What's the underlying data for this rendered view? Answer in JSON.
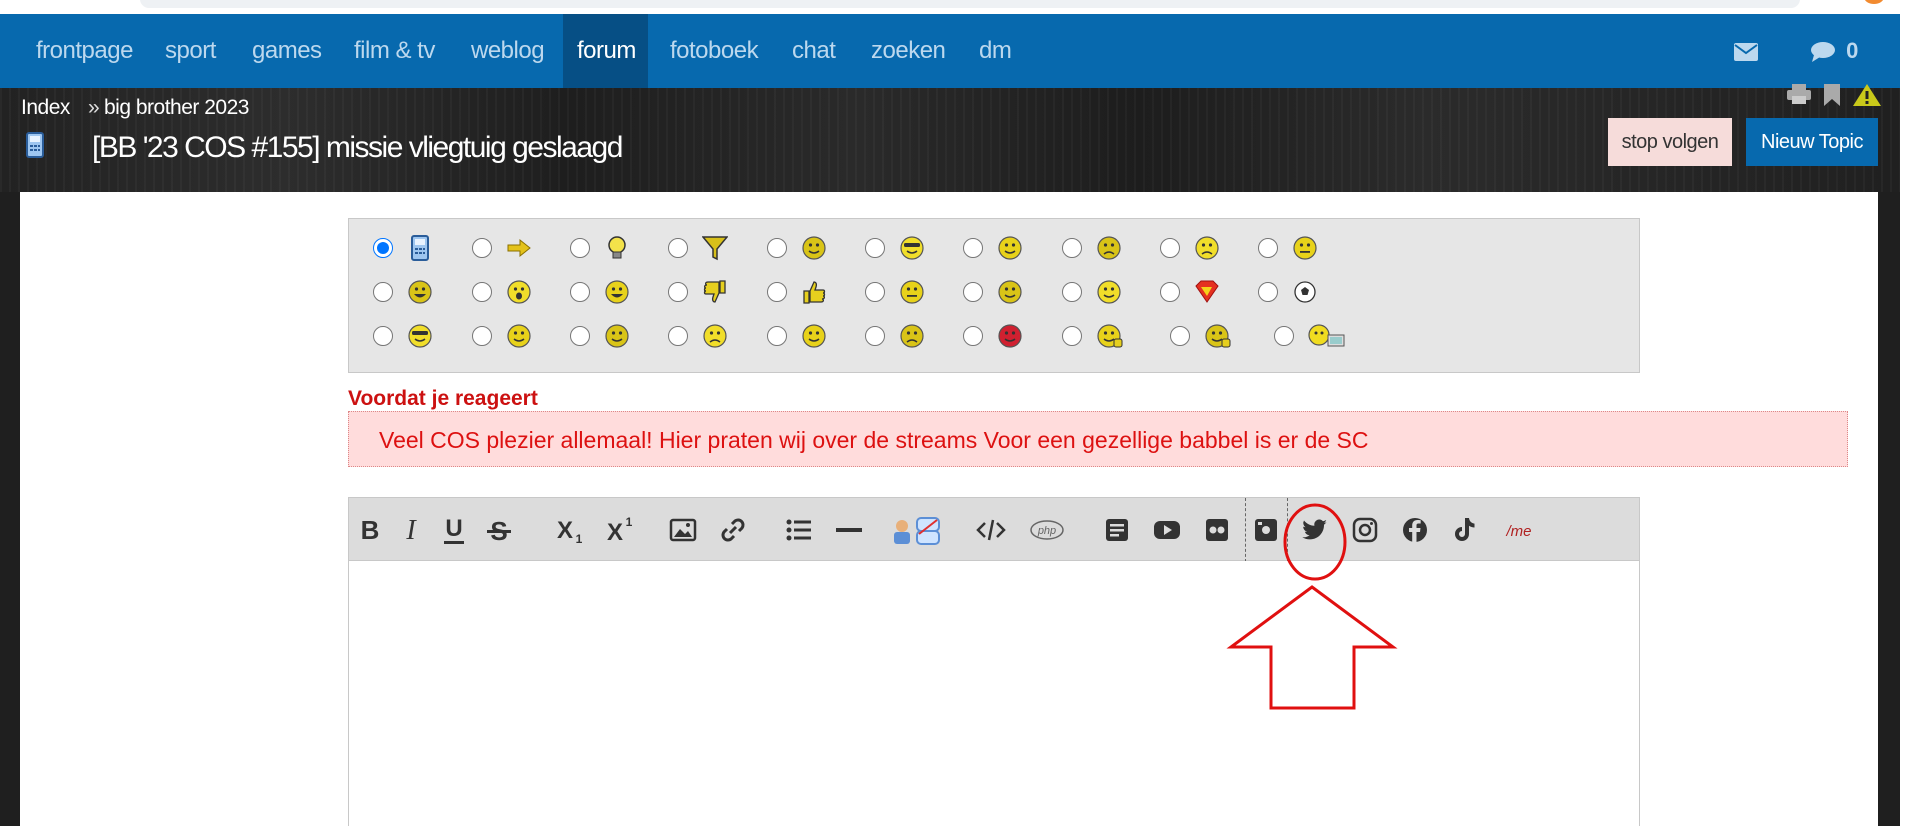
{
  "nav": {
    "items": [
      {
        "label": "frontpage"
      },
      {
        "label": "sport"
      },
      {
        "label": "games"
      },
      {
        "label": "film & tv"
      },
      {
        "label": "weblog"
      },
      {
        "label": "forum",
        "active": true
      },
      {
        "label": "fotoboek"
      },
      {
        "label": "chat"
      },
      {
        "label": "zoeken"
      },
      {
        "label": "dm"
      }
    ],
    "messages_count": "0",
    "icons": [
      "mail-icon",
      "chat-bubble-icon"
    ]
  },
  "breadcrumb": {
    "index": "Index",
    "separator": "»",
    "section": "big brother 2023"
  },
  "topic": {
    "title": "[BB '23 COS #155] missie vliegtuig geslaagd",
    "icons": [
      "print-icon",
      "bookmark-icon",
      "warning-icon"
    ]
  },
  "buttons": {
    "stop_follow": "stop volgen",
    "new_topic": "Nieuw Topic"
  },
  "topic_icons": {
    "selected_index": 0,
    "options": [
      "phone-icon",
      "arrow-icon",
      "lightbulb-icon",
      "funnel-icon",
      "question-icon",
      "cool-smiley-icon",
      "smiley-icon",
      "angry-smiley-icon",
      "frown-smiley-icon",
      "sleepy-smiley-icon",
      "grin-smiley-icon",
      "surprised-smiley-icon",
      "happy-smiley-icon",
      "thumbs-down-icon",
      "thumbs-up-icon",
      "neutral-smiley-icon",
      "tongue-smiley-icon",
      "love-smiley-icon",
      "superman-icon",
      "football-icon",
      "pirate-smiley-icon",
      "wink-smiley-icon",
      "smile-smiley-icon",
      "sad-smiley-icon",
      "blush-smiley-icon",
      "rage-smiley-icon",
      "devil-smiley-icon",
      "thinking-smiley-icon",
      "hmm-smiley-icon",
      "computer-smiley-icon"
    ]
  },
  "notice": {
    "title": "Voordat je reageert",
    "text": "Veel COS plezier allemaal! Hier praten wij over de streams Voor een gezellige babbel is er de SC"
  },
  "toolbar": {
    "buttons": [
      "bold-icon",
      "italic-icon",
      "underline-icon",
      "strikethrough-icon",
      "subscript-icon",
      "superscript-icon",
      "image-icon",
      "link-icon",
      "list-icon",
      "horizontal-rule-icon",
      "quote-icon",
      "code-icon",
      "php-icon",
      "article-icon",
      "youtube-icon",
      "flickr-icon",
      "photobucket-icon",
      "twitter-icon",
      "instagram-icon",
      "facebook-icon",
      "tiktok-icon",
      "me-icon"
    ],
    "php_label": "php",
    "me_label": "/me"
  },
  "colors": {
    "nav_bg": "#0769ae",
    "nav_active_bg": "#064f85",
    "notice_text": "#dd1111",
    "annotation": "#e01010"
  }
}
